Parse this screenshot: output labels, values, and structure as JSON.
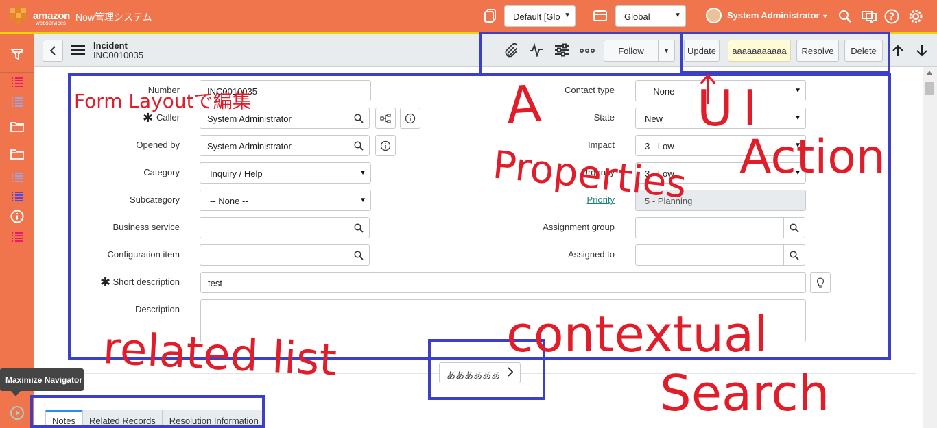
{
  "header": {
    "app_title": "Now管理システム",
    "logo_word": "amazon",
    "logo_sub": "webservices",
    "update_set": "Default [Glo",
    "scope": "Global",
    "user": "System Administrator"
  },
  "form_header": {
    "table": "Incident",
    "number": "INC0010035",
    "follow": "Follow",
    "update": "Update",
    "custom_action": "aaaaaaaaaaa",
    "resolve": "Resolve",
    "delete": "Delete"
  },
  "left_fields": {
    "number": {
      "label": "Number",
      "value": "INC0010035"
    },
    "caller": {
      "label": "Caller",
      "value": "System Administrator"
    },
    "opened_by": {
      "label": "Opened by",
      "value": "System Administrator"
    },
    "category": {
      "label": "Category",
      "value": "Inquiry / Help"
    },
    "subcategory": {
      "label": "Subcategory",
      "value": "-- None --"
    },
    "business_service": {
      "label": "Business service",
      "value": ""
    },
    "configuration_item": {
      "label": "Configuration item",
      "value": ""
    },
    "short_description": {
      "label": "Short description",
      "value": "test"
    },
    "description": {
      "label": "Description",
      "value": ""
    }
  },
  "right_fields": {
    "contact_type": {
      "label": "Contact type",
      "value": "-- None --"
    },
    "state": {
      "label": "State",
      "value": "New"
    },
    "impact": {
      "label": "Impact",
      "value": "3 - Low"
    },
    "urgency": {
      "label": "Urgency",
      "value": "3 - Low"
    },
    "priority": {
      "label": "Priority",
      "value": "5 - Planning"
    },
    "assignment_group": {
      "label": "Assignment group",
      "value": ""
    },
    "assigned_to": {
      "label": "Assigned to",
      "value": ""
    }
  },
  "contextual_search_button": "ああああああ",
  "tooltip": "Maximize Navigator",
  "tabs": [
    "Notes",
    "Related Records",
    "Resolution Information"
  ],
  "annotations": {
    "form_layout": "Form Layoutで編集",
    "a": "A",
    "properties": "Properties",
    "ui": "UI",
    "action": "Action",
    "related_list": "related list",
    "contextual": "contextual",
    "search": "Search"
  },
  "colors": {
    "header_bg": "#f0744c",
    "annotation_box": "#3c40c9",
    "annotation_ink": "#e21d2a"
  }
}
